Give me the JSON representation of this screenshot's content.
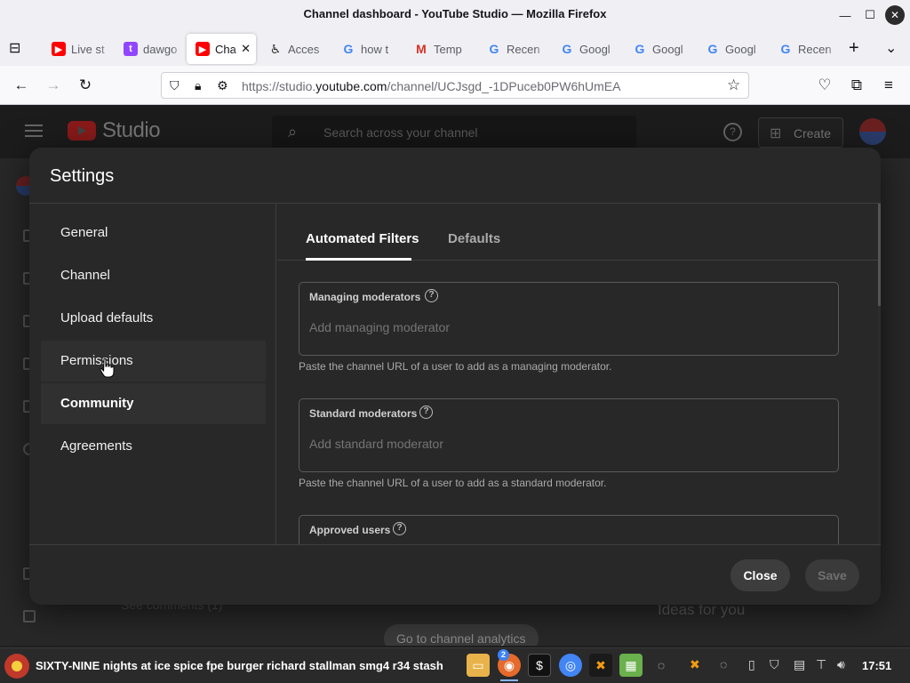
{
  "window": {
    "title": "Channel dashboard - YouTube Studio — Mozilla Firefox"
  },
  "tabs": [
    {
      "label": "Live st",
      "icon": "youtube-icon"
    },
    {
      "label": "dawgo",
      "icon": "twitch-icon"
    },
    {
      "label": "Cha",
      "icon": "youtube-icon",
      "active": true
    },
    {
      "label": "Acces",
      "icon": "accessibility-icon"
    },
    {
      "label": "how t",
      "icon": "google-icon"
    },
    {
      "label": "Temp",
      "icon": "gmail-icon"
    },
    {
      "label": "Recen",
      "icon": "google-icon"
    },
    {
      "label": "Googl",
      "icon": "google-icon"
    },
    {
      "label": "Googl",
      "icon": "google-icon"
    },
    {
      "label": "Googl",
      "icon": "google-icon"
    },
    {
      "label": "Recen",
      "icon": "google-icon"
    }
  ],
  "urlbar": {
    "prefix": "https://studio.",
    "domain": "youtube.com",
    "path": "/channel/UCJsgd_-1DPuceb0PW6hUmEA"
  },
  "studio": {
    "logo_text": "Studio",
    "search_placeholder": "Search across your channel",
    "create_label": "Create",
    "bg_see_comments": "See comments (1)",
    "bg_ideas": "Ideas for you",
    "bg_analytics": "Go to channel analytics"
  },
  "dialog": {
    "title": "Settings",
    "nav": [
      "General",
      "Channel",
      "Upload defaults",
      "Permissions",
      "Community",
      "Agreements"
    ],
    "selected_nav": "Community",
    "tabs": {
      "active": "Automated Filters",
      "inactive": "Defaults"
    },
    "fields": [
      {
        "label": "Managing moderators",
        "placeholder": "Add managing moderator",
        "help": "Paste the channel URL of a user to add as a managing moderator."
      },
      {
        "label": "Standard moderators",
        "placeholder": "Add standard moderator",
        "help": "Paste the channel URL of a user to add as a standard moderator."
      },
      {
        "label": "Approved users",
        "placeholder": "",
        "help": ""
      }
    ],
    "buttons": {
      "close": "Close",
      "save": "Save"
    }
  },
  "taskbar": {
    "title": "SIXTY-NINE nights at ice spice fpe burger richard stallman smg4 r34 stash",
    "badge": "2",
    "clock": "17:51"
  },
  "colors": {
    "youtube_red": "#ff0000",
    "dialog_bg": "#282828",
    "page_bg": "#1f1f1f"
  }
}
